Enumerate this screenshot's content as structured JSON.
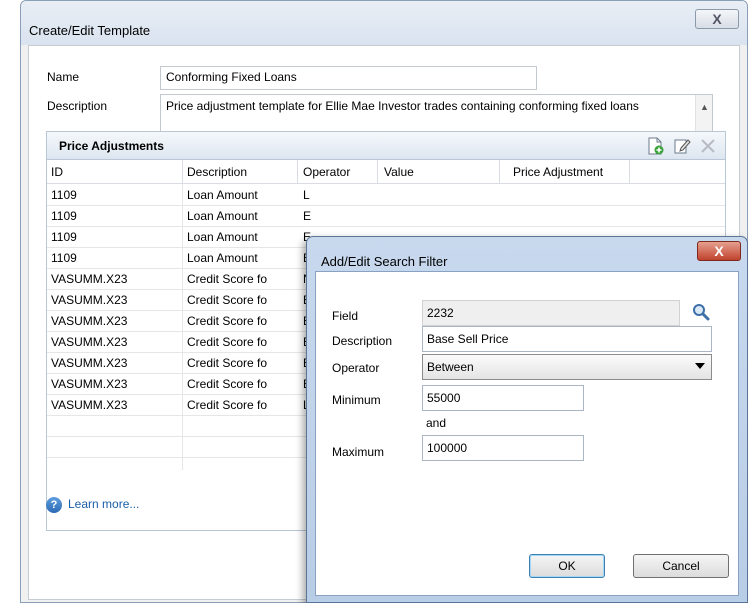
{
  "window": {
    "title": "Create/Edit Template",
    "close_glyph": "X"
  },
  "form": {
    "name_label": "Name",
    "name_value": "Conforming Fixed Loans",
    "description_label": "Description",
    "description_value": "Price adjustment template for Ellie Mae Investor trades containing conforming fixed loans"
  },
  "price_adjustments": {
    "title": "Price Adjustments",
    "toolbar_icons": [
      "add-doc-icon",
      "edit-icon",
      "delete-icon"
    ],
    "columns": [
      "ID",
      "Description",
      "Operator",
      "Value",
      "Price Adjustment"
    ],
    "rows": [
      {
        "id": "1109",
        "description": "Loan Amount",
        "operator": "L"
      },
      {
        "id": "1109",
        "description": "Loan Amount",
        "operator": "E"
      },
      {
        "id": "1109",
        "description": "Loan Amount",
        "operator": "E"
      },
      {
        "id": "1109",
        "description": "Loan Amount",
        "operator": "E"
      },
      {
        "id": "VASUMM.X23",
        "description": "Credit Score fo",
        "operator": "N"
      },
      {
        "id": "VASUMM.X23",
        "description": "Credit Score fo",
        "operator": "E"
      },
      {
        "id": "VASUMM.X23",
        "description": "Credit Score fo",
        "operator": "E"
      },
      {
        "id": "VASUMM.X23",
        "description": "Credit Score fo",
        "operator": "E"
      },
      {
        "id": "VASUMM.X23",
        "description": "Credit Score fo",
        "operator": "E"
      },
      {
        "id": "VASUMM.X23",
        "description": "Credit Score fo",
        "operator": "E"
      },
      {
        "id": "VASUMM.X23",
        "description": "Credit Score fo",
        "operator": "L"
      }
    ]
  },
  "learn_more": "Learn more...",
  "dialog": {
    "title": "Add/Edit Search Filter",
    "close_glyph": "X",
    "field_label": "Field",
    "field_value": "2232",
    "description_label": "Description",
    "description_value": "Base Sell Price",
    "operator_label": "Operator",
    "operator_value": "Between",
    "minimum_label": "Minimum",
    "minimum_value": "55000",
    "and_label": "and",
    "maximum_label": "Maximum",
    "maximum_value": "100000",
    "ok_label": "OK",
    "cancel_label": "Cancel"
  },
  "colors": {
    "accent": "#1a5ea8",
    "dialog_frame": "#b8cde6",
    "close_red": "#c0422d"
  }
}
